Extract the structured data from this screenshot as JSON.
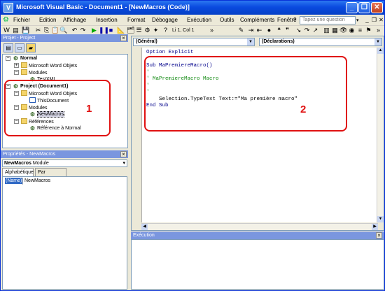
{
  "window": {
    "title": "Microsoft Visual Basic - Document1 - [NewMacros (Code)]"
  },
  "menu": {
    "items": [
      "Fichier",
      "Edition",
      "Affichage",
      "Insertion",
      "Format",
      "Débogage",
      "Exécution",
      "Outils",
      "Compléments",
      "Fenêtre",
      "?"
    ],
    "question_placeholder": "Tapez une question"
  },
  "toolbar": {
    "position_text": "Li 1, Col 1"
  },
  "project": {
    "title": "Projet - Project",
    "tree": [
      {
        "label": "Normal",
        "level": 0,
        "bold": true,
        "expander": "-"
      },
      {
        "label": "Microsoft Word Objets",
        "level": 1,
        "expander": "+"
      },
      {
        "label": "Modules",
        "level": 1,
        "expander": "-"
      },
      {
        "label": "TestXML",
        "level": 2
      },
      {
        "label": "Project (Document1)",
        "level": 0,
        "bold": true,
        "expander": "-"
      },
      {
        "label": "Microsoft Word Objets",
        "level": 1,
        "expander": "-"
      },
      {
        "label": "ThisDocument",
        "level": 2
      },
      {
        "label": "Modules",
        "level": 1,
        "expander": "-"
      },
      {
        "label": "NewMacros",
        "level": 2,
        "selected": true
      },
      {
        "label": "Références",
        "level": 1,
        "expander": "-"
      },
      {
        "label": "Référence à Normal",
        "level": 2
      }
    ],
    "callout_number": "1"
  },
  "properties": {
    "title": "Propriétés - NewMacros",
    "object_name": "NewMacros",
    "object_type": "Module",
    "tabs": [
      "Alphabétique",
      "Par catégorie"
    ],
    "rows": [
      {
        "name": "(Name)",
        "value": "NewMacros"
      }
    ]
  },
  "code": {
    "object_combo": "(Général)",
    "proc_combo": "(Déclarations)",
    "lines": [
      {
        "text": "Option Explicit",
        "kind": "kw"
      },
      {
        "text": "",
        "kind": ""
      },
      {
        "text": "Sub MaPremiereMacro()",
        "kind": "kw"
      },
      {
        "text": "'",
        "kind": "cm"
      },
      {
        "text": "' MaPremiereMacro Macro",
        "kind": "cm"
      },
      {
        "text": "'",
        "kind": "cm"
      },
      {
        "text": "'",
        "kind": "cm"
      },
      {
        "text": "    Selection.TypeText Text:=\"Ma première macro\"",
        "kind": ""
      },
      {
        "text": "End Sub",
        "kind": "kw"
      }
    ],
    "callout_number": "2"
  },
  "execution": {
    "title": "Exécution"
  },
  "icons": [
    "vba-app-icon",
    "minimize-icon",
    "maximize-icon",
    "close-icon",
    "folder-icon",
    "document-icon",
    "module-icon"
  ],
  "colors": {
    "titlebar": "#0a4be0",
    "panel_title": "#7a96df",
    "callout": "#e01010",
    "keyword": "#00008b",
    "comment": "#138a13"
  }
}
